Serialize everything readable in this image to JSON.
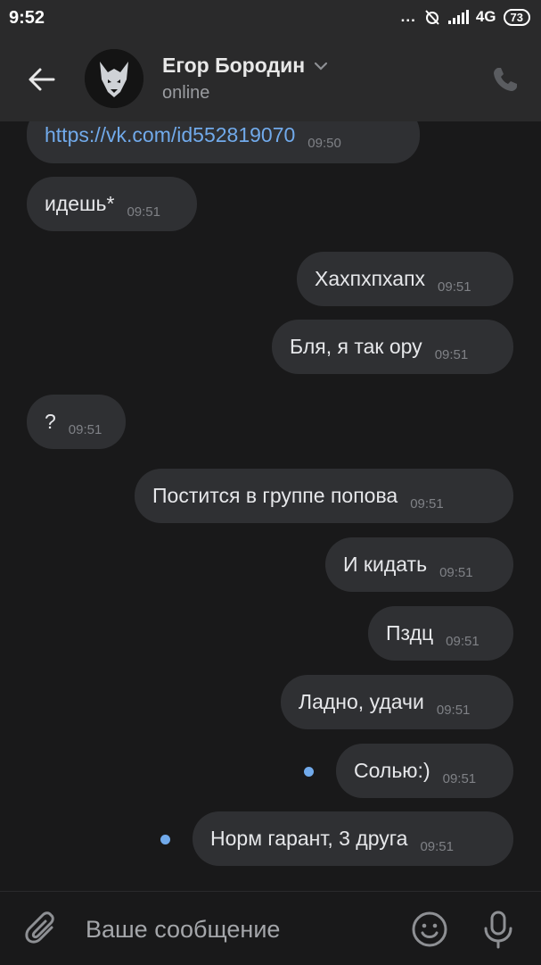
{
  "status_bar": {
    "time": "9:52",
    "dots": "...",
    "network": "4G",
    "battery": "73"
  },
  "header": {
    "contact_name": "Егор Бородин",
    "status": "online"
  },
  "messages": [
    {
      "direction": "incoming",
      "text": "https://vk.com/id552819070",
      "time": "09:50",
      "is_link": true
    },
    {
      "direction": "incoming",
      "text": "идешь*",
      "time": "09:51"
    },
    {
      "direction": "outgoing",
      "text": "Хахпхпхапх",
      "time": "09:51"
    },
    {
      "direction": "outgoing",
      "text": "Бля, я так ору",
      "time": "09:51"
    },
    {
      "direction": "incoming",
      "text": "?",
      "time": "09:51"
    },
    {
      "direction": "outgoing",
      "text": "Постится в группе попова",
      "time": "09:51"
    },
    {
      "direction": "outgoing",
      "text": "И кидать",
      "time": "09:51"
    },
    {
      "direction": "outgoing",
      "text": "Пздц",
      "time": "09:51"
    },
    {
      "direction": "outgoing",
      "text": "Ладно, удачи",
      "time": "09:51"
    },
    {
      "direction": "outgoing",
      "text": "Солью:)",
      "time": "09:51",
      "unread": true
    },
    {
      "direction": "outgoing",
      "text": "Норм гарант, 3 друга",
      "time": "09:51",
      "unread": true
    }
  ],
  "composer": {
    "placeholder": "Ваше сообщение"
  },
  "colors": {
    "background": "#19191a",
    "header": "#2a2a2b",
    "bubble": "#2f3033",
    "accent": "#71aaeb"
  }
}
